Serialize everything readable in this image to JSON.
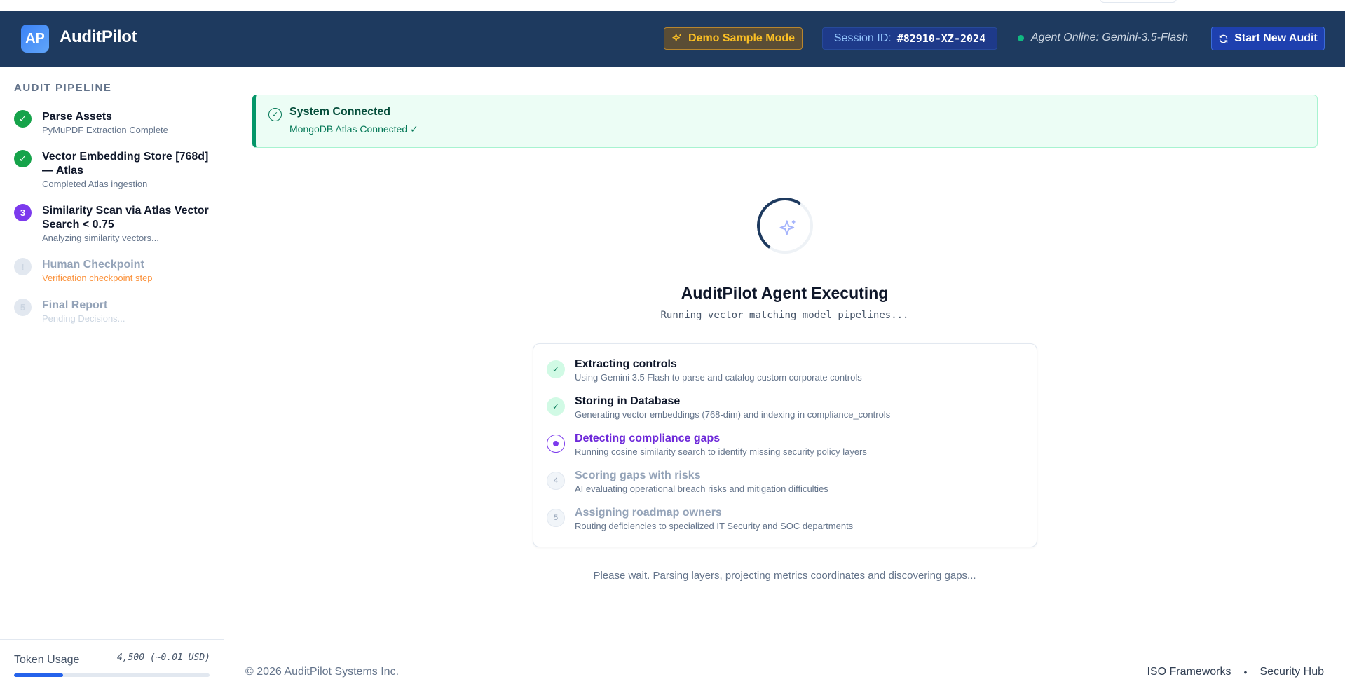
{
  "header": {
    "logo_text": "AP",
    "app_name": "AuditPilot",
    "demo_label": "Demo Sample Mode",
    "session_label": "Session ID:",
    "session_value": "#82910-XZ-2024",
    "agent_status": "Agent Online: Gemini-3.5-Flash",
    "new_audit_label": "Start New Audit"
  },
  "sidebar": {
    "title": "AUDIT PIPELINE",
    "steps": [
      {
        "badge": "✓",
        "title": "Parse Assets",
        "subtitle": "PyMuPDF Extraction Complete",
        "state": "done"
      },
      {
        "badge": "✓",
        "title": "Vector Embedding Store [768d] — Atlas",
        "subtitle": "Completed Atlas ingestion",
        "state": "done"
      },
      {
        "badge": "3",
        "title": "Similarity Scan via Atlas Vector Search < 0.75",
        "subtitle": "Analyzing similarity vectors...",
        "state": "active"
      },
      {
        "badge": "!",
        "title": "Human Checkpoint",
        "subtitle": "Verification checkpoint step",
        "state": "pending"
      },
      {
        "badge": "5",
        "title": "Final Report",
        "subtitle": "Pending Decisions...",
        "state": "pending"
      }
    ],
    "token_label": "Token Usage",
    "token_value": "4,500 (~0.01 USD)",
    "token_fraction": 0.25
  },
  "alert": {
    "title": "System Connected",
    "subtitle": "MongoDB Atlas Connected ✓"
  },
  "executing": {
    "title": "AuditPilot Agent Executing",
    "subtitle": "Running vector matching model pipelines..."
  },
  "tasks": [
    {
      "marker": "✓",
      "title": "Extracting controls",
      "desc": "Using Gemini 3.5 Flash to parse and catalog custom corporate controls",
      "state": "done"
    },
    {
      "marker": "✓",
      "title": "Storing in Database",
      "desc": "Generating vector embeddings (768-dim) and indexing in compliance_controls",
      "state": "done"
    },
    {
      "marker": "",
      "title": "Detecting compliance gaps",
      "desc": "Running cosine similarity search to identify missing security policy layers",
      "state": "running"
    },
    {
      "marker": "4",
      "title": "Scoring gaps with risks",
      "desc": "AI evaluating operational breach risks and mitigation difficulties",
      "state": "waiting"
    },
    {
      "marker": "5",
      "title": "Assigning roadmap owners",
      "desc": "Routing deficiencies to specialized IT Security and SOC departments",
      "state": "waiting"
    }
  ],
  "wait_message": "Please wait. Parsing layers, projecting metrics coordinates and discovering gaps...",
  "footer": {
    "copyright": "© 2026 AuditPilot Systems Inc.",
    "links": [
      "ISO Frameworks",
      "Security Hub"
    ],
    "separator": "•"
  },
  "colors": {
    "header_bg": "#1e3a5f",
    "success": "#16a34a",
    "active": "#7c3aed",
    "demo_accent": "#fbbf24",
    "progress": "#2563eb"
  }
}
